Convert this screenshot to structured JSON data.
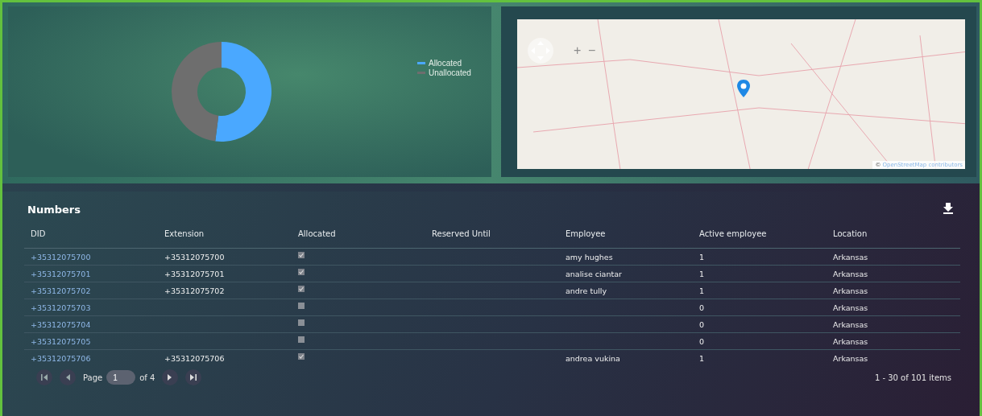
{
  "chart": {
    "legend": [
      {
        "label": "Allocated",
        "color": "#4aa8ff"
      },
      {
        "label": "Unallocated",
        "color": "#6e6e6e"
      }
    ]
  },
  "map": {
    "zoom_in": "+",
    "zoom_out": "−",
    "attribution_symbol": "©",
    "attribution_link": "OpenStreetMap contributors"
  },
  "numbers": {
    "title": "Numbers",
    "columns": [
      "DID",
      "Extension",
      "Allocated",
      "Reserved Until",
      "Employee",
      "Active employee",
      "Location"
    ],
    "rows": [
      {
        "did": "+35312075700",
        "extension": "+35312075700",
        "allocated": true,
        "employee": "amy hughes",
        "active": "1",
        "location": "Arkansas"
      },
      {
        "did": "+35312075701",
        "extension": "+35312075701",
        "allocated": true,
        "employee": "analise ciantar",
        "active": "1",
        "location": "Arkansas"
      },
      {
        "did": "+35312075702",
        "extension": "+35312075702",
        "allocated": true,
        "employee": "andre tully",
        "active": "1",
        "location": "Arkansas"
      },
      {
        "did": "+35312075703",
        "allocated": false,
        "active": "0",
        "location": "Arkansas"
      },
      {
        "did": "+35312075704",
        "allocated": false,
        "active": "0",
        "location": "Arkansas"
      },
      {
        "did": "+35312075705",
        "allocated": false,
        "active": "0",
        "location": "Arkansas"
      },
      {
        "did": "+35312075706",
        "extension": "+35312075706",
        "allocated": true,
        "employee": "andrea vukina",
        "active": "1",
        "location": "Arkansas"
      }
    ],
    "pager": {
      "page_label": "Page",
      "page": "1",
      "of": "of 4",
      "summary": "1 - 30 of 101 items"
    }
  }
}
